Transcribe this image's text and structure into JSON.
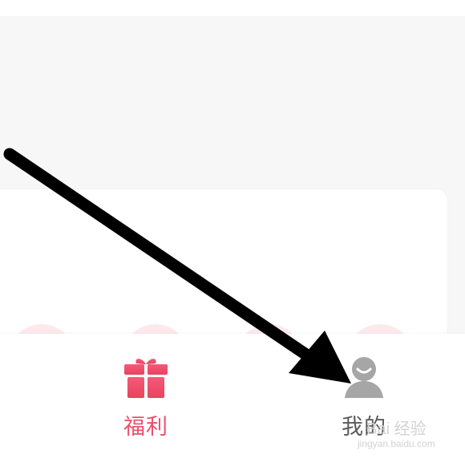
{
  "tab_bar": {
    "tabs": [
      {
        "label": "福利",
        "icon": "gift-icon",
        "active": true
      },
      {
        "label": "我的",
        "icon": "profile-icon",
        "active": false
      }
    ],
    "colors": {
      "active": "#e8516c",
      "inactive": "#5a5a5a",
      "inactive_icon": "#a6a6a6"
    }
  },
  "annotation": {
    "icon": "arrow-icon",
    "color": "#000000"
  },
  "watermark": {
    "brand": "Bai 经验",
    "url": "jingyan.baidu.com"
  },
  "background": {
    "page": "#f7f7f7",
    "card": "#ffffff",
    "accent_circle": "#fde9ec"
  }
}
